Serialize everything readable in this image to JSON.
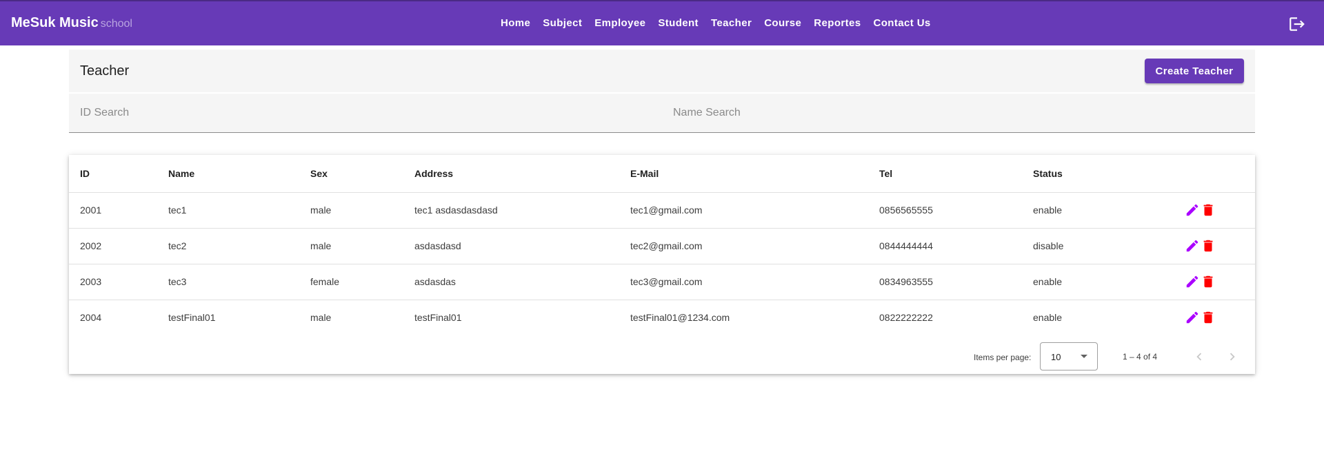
{
  "app": {
    "brand": "MeSuk Music",
    "brand_sub": "school",
    "accent_color": "#673ab7"
  },
  "nav": {
    "items": [
      {
        "label": "Home"
      },
      {
        "label": "Subject"
      },
      {
        "label": "Employee"
      },
      {
        "label": "Student"
      },
      {
        "label": "Teacher"
      },
      {
        "label": "Course"
      },
      {
        "label": "Reportes"
      },
      {
        "label": "Contact Us"
      }
    ],
    "logout_icon": "logout-icon"
  },
  "page": {
    "title": "Teacher",
    "create_button": "Create Teacher"
  },
  "search": {
    "id_placeholder": "ID Search",
    "id_value": "",
    "name_placeholder": "Name Search",
    "name_value": ""
  },
  "table": {
    "columns": [
      "ID",
      "Name",
      "Sex",
      "Address",
      "E-Mail",
      "Tel",
      "Status"
    ],
    "rows": [
      {
        "id": "2001",
        "name": "tec1",
        "sex": "male",
        "address": "tec1 asdasdasdasd",
        "email": "tec1@gmail.com",
        "tel": "0856565555",
        "status": "enable"
      },
      {
        "id": "2002",
        "name": "tec2",
        "sex": "male",
        "address": "asdasdasd",
        "email": "tec2@gmail.com",
        "tel": "0844444444",
        "status": "disable"
      },
      {
        "id": "2003",
        "name": "tec3",
        "sex": "female",
        "address": "asdasdas",
        "email": "tec3@gmail.com",
        "tel": "0834963555",
        "status": "enable"
      },
      {
        "id": "2004",
        "name": "testFinal01",
        "sex": "male",
        "address": "testFinal01",
        "email": "testFinal01@1234.com",
        "tel": "0822222222",
        "status": "enable"
      }
    ],
    "edit_icon": "pencil-icon",
    "edit_color": "#aa00ff",
    "delete_icon": "trash-icon",
    "delete_color": "#ff0000"
  },
  "paginator": {
    "items_per_page_label": "Items per page:",
    "page_size": "10",
    "range_label": "1 – 4 of 4"
  }
}
